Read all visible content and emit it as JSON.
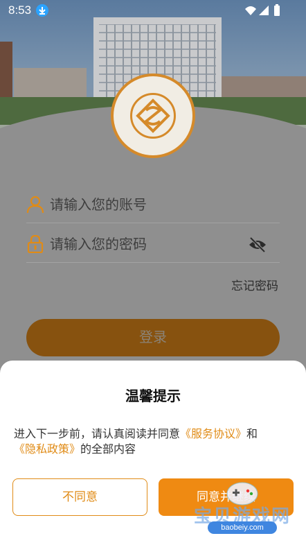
{
  "status_bar": {
    "time": "8:53",
    "icons": [
      "download-icon",
      "wifi-icon",
      "signal-icon",
      "battery-icon"
    ]
  },
  "login": {
    "username_placeholder": "请输入您的账号",
    "password_placeholder": "请输入您的密码",
    "forgot_password": "忘记密码",
    "login_button": "登录"
  },
  "dialog": {
    "title": "温馨提示",
    "text_before": "进入下一步前，请认真阅读并同意",
    "service_link": "《服务协议》",
    "text_and": "和",
    "privacy_link": "《隐私政策》",
    "text_after": "的全部内容",
    "disagree_button": "不同意",
    "agree_button": "同意并继续"
  },
  "watermark": {
    "text": "宝贝游戏网",
    "url": "baobeiy.com"
  },
  "colors": {
    "accent": "#ef8a12",
    "link": "#e08b16",
    "overlay": "#8f8f8f"
  }
}
